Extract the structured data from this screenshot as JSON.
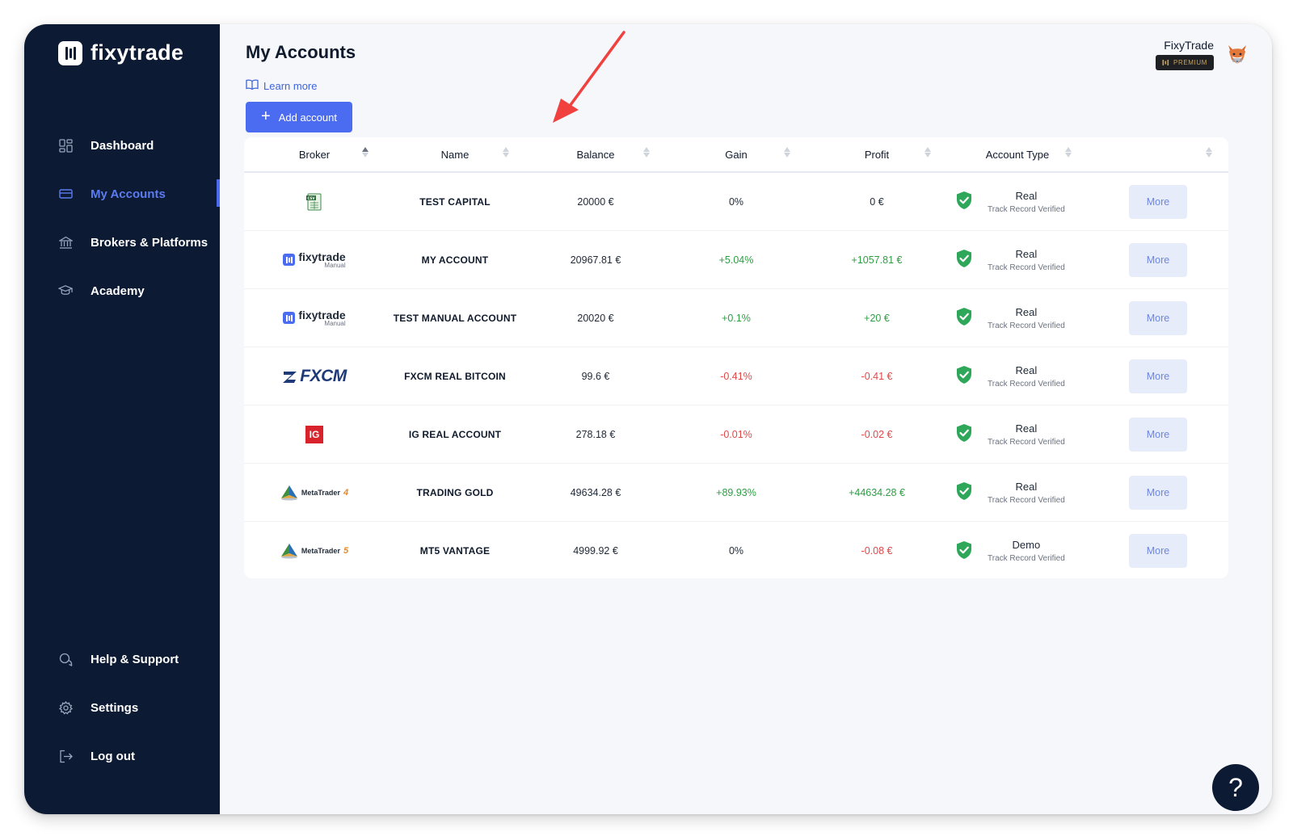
{
  "app": {
    "logo_text": "fixytrade"
  },
  "sidebar": {
    "top_items": [
      {
        "label": "Dashboard",
        "icon": "grid-icon"
      },
      {
        "label": "My Accounts",
        "icon": "card-icon"
      },
      {
        "label": "Brokers & Platforms",
        "icon": "bank-icon"
      },
      {
        "label": "Academy",
        "icon": "graduation-cap-icon"
      }
    ],
    "bottom_items": [
      {
        "label": "Help & Support",
        "icon": "chat-icon"
      },
      {
        "label": "Settings",
        "icon": "gear-icon"
      },
      {
        "label": "Log out",
        "icon": "logout-icon"
      }
    ],
    "active": "My Accounts"
  },
  "header": {
    "title": "My Accounts",
    "learn_more": "Learn more",
    "add_account": "Add account",
    "user_name": "FixyTrade",
    "badge": "PREMIUM"
  },
  "table": {
    "columns": [
      "Broker",
      "Name",
      "Balance",
      "Gain",
      "Profit",
      "Account Type",
      ""
    ],
    "more_label": "More",
    "rows": [
      {
        "broker": "csv",
        "name": "TEST CAPITAL",
        "balance": "20000 €",
        "gain": "0%",
        "gain_sign": "zero",
        "profit": "0 €",
        "profit_sign": "zero",
        "type": "Real",
        "verified": "Track Record Verified"
      },
      {
        "broker": "fixytrade",
        "broker_text": "fixytrade",
        "broker_sub": "Manual",
        "name": "MY ACCOUNT",
        "balance": "20967.81 €",
        "gain": "+5.04%",
        "gain_sign": "pos",
        "profit": "+1057.81 €",
        "profit_sign": "pos",
        "type": "Real",
        "verified": "Track Record Verified"
      },
      {
        "broker": "fixytrade",
        "broker_text": "fixytrade",
        "broker_sub": "Manual",
        "name": "TEST MANUAL ACCOUNT",
        "balance": "20020 €",
        "gain": "+0.1%",
        "gain_sign": "pos",
        "profit": "+20 €",
        "profit_sign": "pos",
        "type": "Real",
        "verified": "Track Record Verified"
      },
      {
        "broker": "fxcm",
        "broker_text": "FXCM",
        "name": "FXCM REAL BITCOIN",
        "balance": "99.6 €",
        "gain": "-0.41%",
        "gain_sign": "neg",
        "profit": "-0.41 €",
        "profit_sign": "neg",
        "type": "Real",
        "verified": "Track Record Verified"
      },
      {
        "broker": "ig",
        "broker_text": "IG",
        "name": "IG REAL ACCOUNT",
        "balance": "278.18 €",
        "gain": "-0.01%",
        "gain_sign": "neg",
        "profit": "-0.02 €",
        "profit_sign": "neg",
        "type": "Real",
        "verified": "Track Record Verified"
      },
      {
        "broker": "mt",
        "broker_text": "MetaTrader",
        "broker_ver": "4",
        "name": "TRADING GOLD",
        "balance": "49634.28 €",
        "gain": "+89.93%",
        "gain_sign": "pos",
        "profit": "+44634.28 €",
        "profit_sign": "pos",
        "type": "Real",
        "verified": "Track Record Verified"
      },
      {
        "broker": "mt",
        "broker_text": "MetaTrader",
        "broker_ver": "5",
        "name": "MT5 VANTAGE",
        "balance": "4999.92 €",
        "gain": "0%",
        "gain_sign": "zero",
        "profit": "-0.08 €",
        "profit_sign": "neg",
        "type": "Demo",
        "verified": "Track Record Verified"
      }
    ]
  },
  "help_button": "?",
  "colors": {
    "sidebar": "#0c1a33",
    "accent": "#4b6cf0",
    "positive": "#2e9e44",
    "negative": "#e04848",
    "verified": "#2fa75a"
  }
}
